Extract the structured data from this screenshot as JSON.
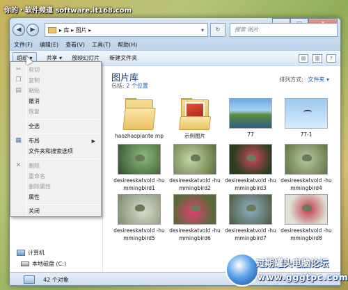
{
  "watermark": "你的・软件频道 software.it168.com",
  "address": {
    "path": "▸ 库 ▸ 图片 ▸",
    "search_placeholder": "搜索 图片"
  },
  "menubar": [
    "文件(F)",
    "编辑(E)",
    "查看(V)",
    "工具(T)",
    "帮助(H)"
  ],
  "toolbar": {
    "organize": "组织 ▾",
    "share": "共享 ▾",
    "slideshow": "放映幻灯片",
    "new_folder": "新建文件夹"
  },
  "library": {
    "title": "图片库",
    "subtitle_prefix": "包括:",
    "subtitle_link": "2 个位置",
    "arrange_label": "排列方式:",
    "arrange_value": "文件夹 ▾"
  },
  "items": [
    {
      "name": "haozhaopiante mp"
    },
    {
      "name": "示例图片"
    },
    {
      "name": "77"
    },
    {
      "name": "77-1"
    },
    {
      "name": "desireeskatvold -hummingbird1"
    },
    {
      "name": "desireeskatvold -hummingbird2"
    },
    {
      "name": "desireeskatvold -hummingbird3"
    },
    {
      "name": "desireeskatvold -hummingbird4"
    },
    {
      "name": "desireeskatvold -hummingbird5"
    },
    {
      "name": "desireeskatvold -hummingbird6"
    },
    {
      "name": "desireeskatvold -hummingbird7"
    },
    {
      "name": "desireeskatvold -hummingbird8"
    }
  ],
  "nav": {
    "computer": "计算机",
    "local_disk": "本地磁盘 (C:)"
  },
  "status": {
    "count": "42 个对象"
  },
  "context_menu": {
    "cut": "剪切",
    "copy": "复制",
    "paste": "粘贴",
    "undo": "撤消",
    "redo": "恢复",
    "select_all": "全选",
    "layout": "布局",
    "folder_options": "文件夹和搜索选项",
    "delete": "删除",
    "rename": "重命名",
    "remove_properties": "删除属性",
    "properties": "属性",
    "close": "关闭"
  },
  "badge": {
    "line1": "过期罐头电脑论坛",
    "line2": "www.gggtpc.com"
  }
}
